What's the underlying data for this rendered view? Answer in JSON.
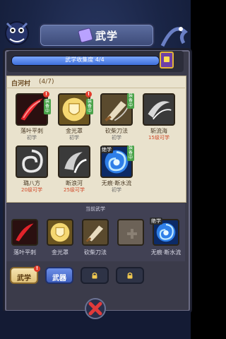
{
  "header": {
    "title": "武学"
  },
  "collection": {
    "label": "武学收集度",
    "progress": "4/4",
    "fraction": 1.0
  },
  "section": {
    "name": "白河村",
    "count": "(4/7)"
  },
  "skills": [
    {
      "name": "落叶平刺",
      "sub": "初学",
      "alert": "!",
      "tag": "装备中"
    },
    {
      "name": "金光罩",
      "sub": "初学",
      "alert": "!",
      "tag": "装备中"
    },
    {
      "name": "砍柴刀法",
      "sub": "初学",
      "tag": "装备中"
    },
    {
      "name": "斩流海",
      "sub": "15级可学"
    },
    {
      "name": "璐八方",
      "sub": "20级可学"
    },
    {
      "name": "断浪河",
      "sub": "25级可学"
    },
    {
      "name": "无痕·断水流",
      "sub": "初学",
      "ultimate": "绝学",
      "tag": "装备中"
    }
  ],
  "equipped": {
    "label": "当前武学",
    "slots": [
      {
        "name": "落叶平刺"
      },
      {
        "name": "金光罩"
      },
      {
        "name": "砍柴刀法"
      },
      {
        "name": ""
      },
      {
        "name": "无痕·断水流",
        "ultimate": "绝学"
      }
    ]
  },
  "tabs": {
    "martial": "武学",
    "martial_alert": "!",
    "weapon": "武器"
  },
  "colors": {
    "accent": "#3f6fd8",
    "equipped_tag": "#4aa34a",
    "alert": "#e23a2a",
    "requirement": "#d04a2a"
  },
  "icons": [
    "dragon-icon",
    "scroll-icon",
    "chest-icon",
    "lock-icon",
    "plus-icon",
    "close-icon"
  ]
}
